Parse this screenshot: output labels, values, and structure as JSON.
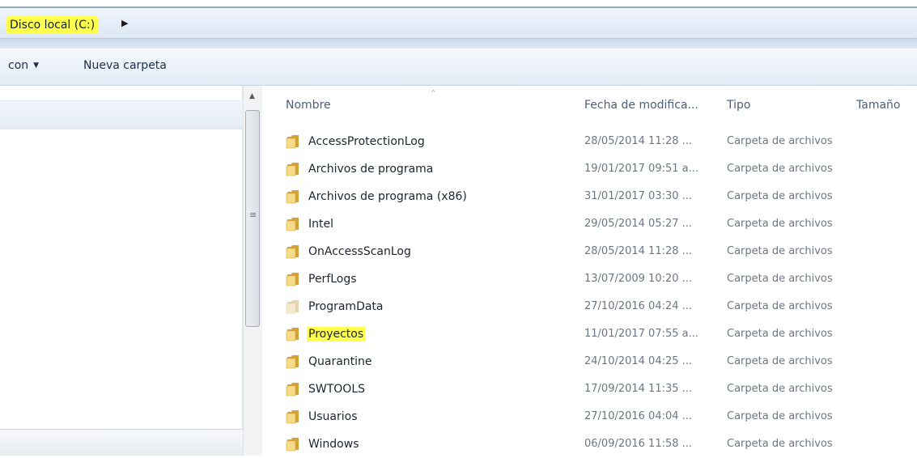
{
  "address": {
    "crumb": "Disco local (C:)",
    "arrow": "▶"
  },
  "toolbar": {
    "organize_label": "con",
    "organize_caret": "▼",
    "new_folder_label": "Nueva carpeta"
  },
  "scrollbar": {
    "up_arrow": "▲",
    "grip": "≡"
  },
  "columns": {
    "name": "Nombre",
    "sort_indicator": "^",
    "date": "Fecha de modifica...",
    "type": "Tipo",
    "size": "Tamaño"
  },
  "files": [
    {
      "name": "AccessProtectionLog",
      "date": "28/05/2014 11:28 ...",
      "type": "Carpeta de archivos",
      "icon": "folder-icon"
    },
    {
      "name": "Archivos de programa",
      "date": "19/01/2017 09:51 a...",
      "type": "Carpeta de archivos",
      "icon": "folder-icon"
    },
    {
      "name": "Archivos de programa (x86)",
      "date": "31/01/2017 03:30 ...",
      "type": "Carpeta de archivos",
      "icon": "folder-icon"
    },
    {
      "name": "Intel",
      "date": "29/05/2014 05:27 ...",
      "type": "Carpeta de archivos",
      "icon": "folder-icon"
    },
    {
      "name": "OnAccessScanLog",
      "date": "28/05/2014 11:28 ...",
      "type": "Carpeta de archivos",
      "icon": "folder-icon"
    },
    {
      "name": "PerfLogs",
      "date": "13/07/2009 10:20 ...",
      "type": "Carpeta de archivos",
      "icon": "folder-icon"
    },
    {
      "name": "ProgramData",
      "date": "27/10/2016 04:24 ...",
      "type": "Carpeta de archivos",
      "icon": "folder-hidden-icon"
    },
    {
      "name": "Proyectos",
      "date": "11/01/2017 07:55 a...",
      "type": "Carpeta de archivos",
      "icon": "folder-icon",
      "highlighted": true
    },
    {
      "name": "Quarantine",
      "date": "24/10/2014 04:25 ...",
      "type": "Carpeta de archivos",
      "icon": "folder-icon"
    },
    {
      "name": "SWTOOLS",
      "date": "17/09/2014 11:35 ...",
      "type": "Carpeta de archivos",
      "icon": "folder-icon"
    },
    {
      "name": "Usuarios",
      "date": "27/10/2016 04:04 ...",
      "type": "Carpeta de archivos",
      "icon": "folder-icon"
    },
    {
      "name": "Windows",
      "date": "06/09/2016 11:58 ...",
      "type": "Carpeta de archivos",
      "icon": "folder-icon"
    }
  ],
  "colors": {
    "highlight": "#ffff4d",
    "folder_light": "#f5dc8a",
    "folder_dark": "#d4a237",
    "folder_hidden": "#f4ead0"
  }
}
